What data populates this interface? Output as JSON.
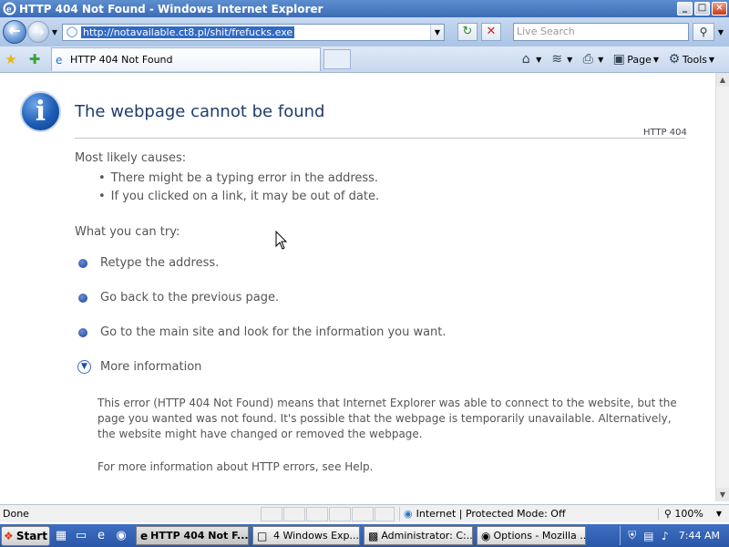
{
  "window": {
    "title": "HTTP 404 Not Found - Windows Internet Explorer",
    "buttons": {
      "minimize": "_",
      "maximize": "□",
      "close": "×"
    }
  },
  "address_bar": {
    "url": "http://notavailable.ct8.pl/shit/frefucks.exe",
    "search_placeholder": "Live Search"
  },
  "tabs": [
    {
      "label": "HTTP 404 Not Found"
    }
  ],
  "commands": {
    "page": "Page",
    "tools": "Tools"
  },
  "content": {
    "heading": "The webpage cannot be found",
    "code": "HTTP 404",
    "causes_title": "Most likely causes:",
    "causes": [
      "There might be a typing error in the address.",
      "If you clicked on a link, it may be out of date."
    ],
    "try_title": "What you can try:",
    "try_items": [
      "Retype the address.",
      "Go back to the previous page.",
      "Go to the main site and look for the information you want."
    ],
    "more_info": "More information",
    "details": "This error (HTTP 404 Not Found) means that Internet Explorer was able to connect to the website, but the page you wanted was not found. It's possible that the webpage is temporarily unavailable. Alternatively, the website might have changed or removed the webpage.",
    "help_line": "For more information about HTTP errors, see Help."
  },
  "status_bar": {
    "text": "Done",
    "zone": "Internet | Protected Mode: Off",
    "zoom": "100%"
  },
  "taskbar": {
    "start": "Start",
    "tasks": [
      {
        "label": "HTTP 404 Not F...",
        "icon": "ie-icon",
        "active": true
      },
      {
        "label": "4 Windows Exp...",
        "icon": "folder-icon",
        "active": false
      },
      {
        "label": "Administrator: C:...",
        "icon": "cmd-icon",
        "active": false
      },
      {
        "label": "Options - Mozilla ...",
        "icon": "firefox-icon",
        "active": false
      }
    ],
    "clock": "7:44 AM"
  }
}
